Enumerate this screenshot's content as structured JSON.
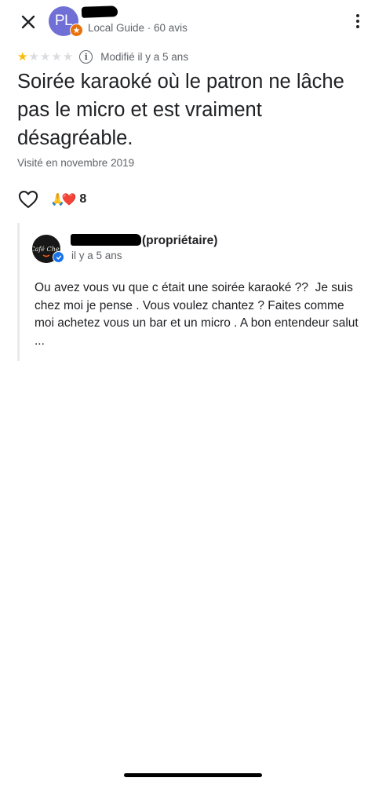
{
  "header": {
    "avatar_initials": "PL",
    "author_meta": "Local Guide · 60 avis",
    "close_icon": "close-icon",
    "more_icon": "more-vert-icon"
  },
  "review": {
    "rating": 1,
    "max_rating": 5,
    "star_color": "#fbbc04",
    "modified": "Modifié il y a 5 ans",
    "title": "Soirée karaoké où le patron ne lâche pas le micro et est vraiment désagréable.",
    "visited": "Visité en novembre 2019"
  },
  "reactions": {
    "emoji": "🙏❤️",
    "count": "8"
  },
  "owner_response": {
    "owner_label": "(propriétaire)",
    "date": "il y a 5 ans",
    "logo_text": "Café Chez",
    "text": "Ou avez vous vu que c était une soirée karaoké ??  Je suis chez moi je pense . Vous voulez chantez ? Faites comme moi achetez vous un bar et un micro . A bon entendeur salut ..."
  },
  "colors": {
    "avatar_bg": "#6f6fd6",
    "local_guide_badge": "#e8710a",
    "verified_badge": "#1a73e8",
    "secondary_text": "#5f6368"
  }
}
